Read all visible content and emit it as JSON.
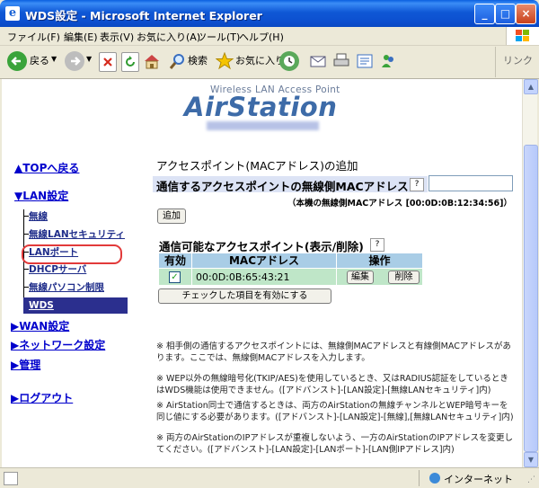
{
  "window": {
    "title": "WDS設定 - Microsoft Internet Explorer"
  },
  "menu": [
    "ファイル(F)",
    "編集(E)",
    "表示(V)",
    "お気に入り(A)",
    "ツール(T)",
    "ヘルプ(H)"
  ],
  "toolbar": {
    "back": "戻る",
    "search": "検索",
    "favorites": "お気に入り",
    "links": "リンク"
  },
  "logo": {
    "subtitle": "Wireless LAN Access Point",
    "main": "AirStation"
  },
  "sidebar": {
    "top": "▲TOPへ戻る",
    "lan": "▼LAN設定",
    "sub": [
      "無線",
      "無線LANセキュリティ",
      "LANポート",
      "DHCPサーバ",
      "無線パソコン制限"
    ],
    "wds": "WDS",
    "wan": "▶WAN設定",
    "network": "▶ネットワーク設定",
    "admin": "▶管理",
    "logout": "▶ログアウト"
  },
  "main": {
    "add_title": "アクセスポイント(MACアドレス)の追加",
    "mac_label": "通信するアクセスポイントの無線側MACアドレス",
    "own_mac": "（本機の無線側MACアドレス [00:0D:0B:12:34:56]）",
    "add_button": "追加",
    "list_title": "通信可能なアクセスポイント(表示/削除)",
    "col_enable": "有効",
    "col_mac": "MACアドレス",
    "col_ops": "操作",
    "row_mac": "00:0D:0B:65:43:21",
    "row_checked": true,
    "edit_button": "編集",
    "delete_button": "削除",
    "apply_button": "チェックした項目を有効にする"
  },
  "notes": [
    "※ 相手側の通信するアクセスポイントには、無線側MACアドレスと有線側MACアドレスがあります。ここでは、無線側MACアドレスを入力します。",
    "※ WEP以外の無線暗号化(TKIP/AES)を使用しているとき、又はRADIUS認証をしているときはWDS機能は使用できません。([アドバンスト]-[LAN設定]-[無線LANセキュリティ]内)",
    "※ AirStation同士で通信するときは、両方のAirStationの無線チャンネルとWEP暗号キーを同じ値にする必要があります。([アドバンスト]-[LAN設定]-[無線],[無線LANセキュリティ]内)",
    "※ 両方のAirStationのIPアドレスが重複しないよう、一方のAirStationのIPアドレスを変更してください。([アドバンスト]-[LAN設定]-[LANポート]-[LAN側IPアドレス]内)"
  ],
  "status": {
    "zone": "インターネット"
  },
  "colors": {
    "title_bar": "#0c4fcf",
    "sidebar_selected": "#2b2f8e",
    "table_header": "#a9cde6",
    "table_row": "#bfe6c8",
    "highlight_ring": "#e23a3a"
  }
}
